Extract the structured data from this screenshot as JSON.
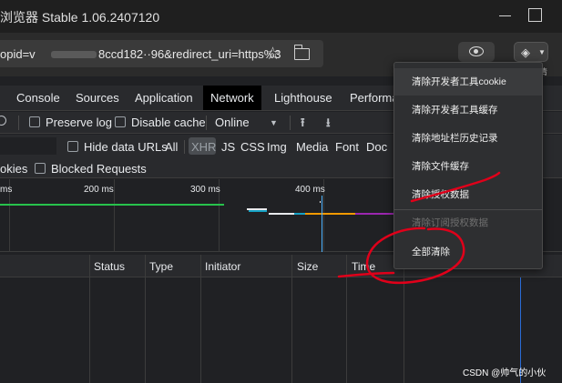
{
  "window": {
    "title": "浏览器 Stable 1.06.2407120"
  },
  "address": {
    "url_start": "opid=v",
    "url_end": "8ccd182··96&redirect_uri=https%3"
  },
  "toolbar": {
    "clear_label": "清"
  },
  "devtools": {
    "tabs": [
      "Console",
      "Sources",
      "Application",
      "Network",
      "Lighthouse",
      "Performa"
    ],
    "active_tab": "Network",
    "preserve_log": "Preserve log",
    "disable_cache": "Disable cache",
    "throttle": "Online",
    "hide_data_urls": "Hide data URLs",
    "filters": [
      "All",
      "XHR",
      "JS",
      "CSS",
      "Img",
      "Media",
      "Font",
      "Doc"
    ],
    "cookies_partial": "okies",
    "blocked_requests": "Blocked Requests"
  },
  "timeline": {
    "labels": [
      "ms",
      "200 ms",
      "300 ms",
      "400 ms"
    ]
  },
  "table": {
    "columns": [
      "Status",
      "Type",
      "Initiator",
      "Size",
      "Time"
    ]
  },
  "menu": {
    "items": [
      "清除开发者工具cookie",
      "清除开发者工具缓存",
      "清除地址栏历史记录",
      "清除文件缓存",
      "清除授权数据",
      "清除订阅授权数据",
      "全部清除"
    ]
  },
  "watermark": "CSDN @帅气的小伙",
  "colors": {
    "annotation": "#e0001a",
    "accent_blue": "#4fb3ff"
  }
}
